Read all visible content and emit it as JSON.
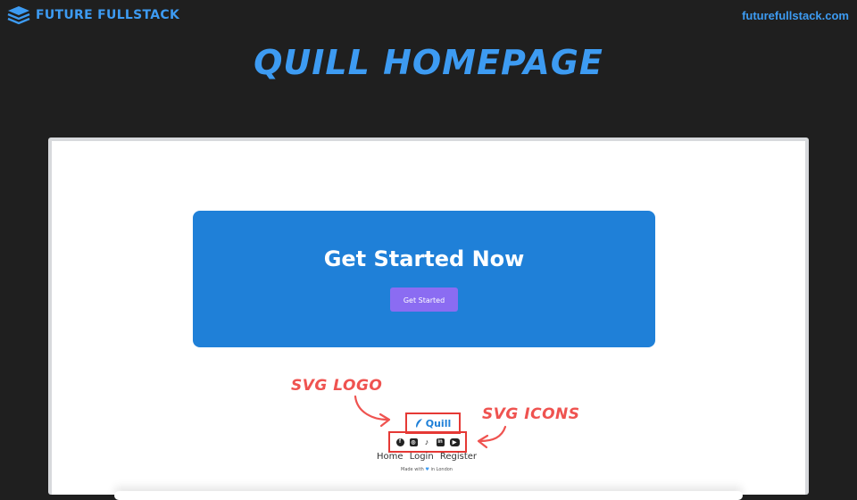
{
  "header": {
    "brand_name": "FUTURE FULLSTACK",
    "site_url": "futurefullstack.com",
    "title": "QUILL HOMEPAGE"
  },
  "colors": {
    "background": "#1f1f1f",
    "accent": "#3d9bf2",
    "cta_blue": "#1f80d8",
    "button_purple": "#8b6cf2",
    "annotation_red": "#ef5350"
  },
  "preview": {
    "cta": {
      "heading": "Get Started Now",
      "button_label": "Get Started"
    },
    "footer": {
      "logo_text": "Quill",
      "social_icons": [
        "facebook-icon",
        "instagram-icon",
        "tiktok-icon",
        "linkedin-icon",
        "youtube-icon"
      ],
      "nav": [
        "Home",
        "Login",
        "Register"
      ],
      "made_with_prefix": "Made with",
      "made_with_suffix": "in London"
    }
  },
  "annotations": {
    "logo_label": "SVG LOGO",
    "icons_label": "SVG ICONS"
  }
}
